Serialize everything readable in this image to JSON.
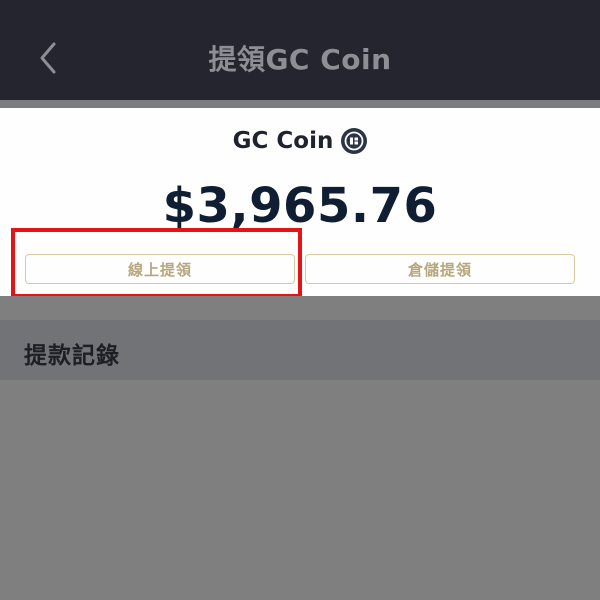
{
  "header": {
    "title": "提領GC Coin",
    "back_icon": "chevron-left-icon"
  },
  "wallet": {
    "coin_name": "GC Coin",
    "coin_icon": "gc-coin-icon",
    "balance": "$3,965.76"
  },
  "actions": {
    "online_withdraw_label": "線上提領",
    "warehouse_withdraw_label": "倉儲提領"
  },
  "records": {
    "title": "提款記錄"
  },
  "colors": {
    "header_bg": "#25252f",
    "accent_gold": "#b6a77c",
    "highlight_red": "#e51414",
    "balance_text": "#0f1e33"
  }
}
